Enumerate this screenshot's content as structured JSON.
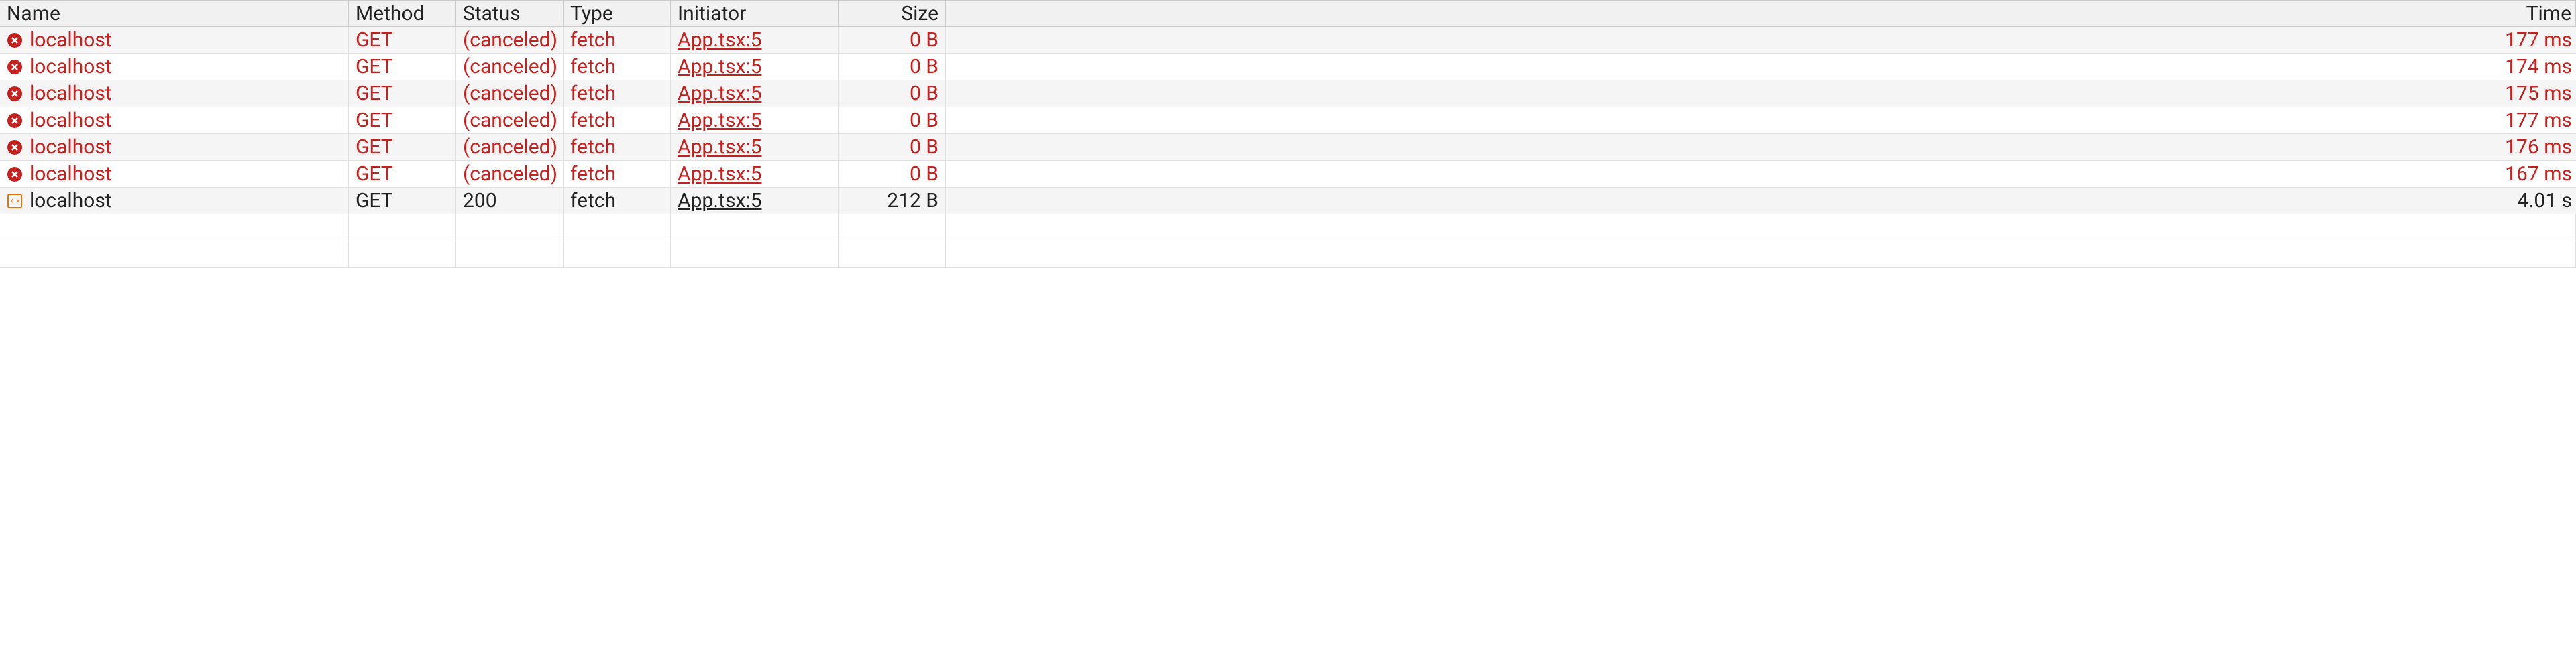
{
  "columns": {
    "name": "Name",
    "method": "Method",
    "status": "Status",
    "type": "Type",
    "initiator": "Initiator",
    "size": "Size",
    "time": "Time"
  },
  "status_colors": {
    "error": "#c5221f",
    "ok": "#222222",
    "script_icon_border": "#e8710a"
  },
  "rows": [
    {
      "icon": "error",
      "name": "localhost",
      "method": "GET",
      "status": "(canceled)",
      "type": "fetch",
      "initiator": "App.tsx:5",
      "size": "0 B",
      "time": "177 ms",
      "state": "err"
    },
    {
      "icon": "error",
      "name": "localhost",
      "method": "GET",
      "status": "(canceled)",
      "type": "fetch",
      "initiator": "App.tsx:5",
      "size": "0 B",
      "time": "174 ms",
      "state": "err"
    },
    {
      "icon": "error",
      "name": "localhost",
      "method": "GET",
      "status": "(canceled)",
      "type": "fetch",
      "initiator": "App.tsx:5",
      "size": "0 B",
      "time": "175 ms",
      "state": "err"
    },
    {
      "icon": "error",
      "name": "localhost",
      "method": "GET",
      "status": "(canceled)",
      "type": "fetch",
      "initiator": "App.tsx:5",
      "size": "0 B",
      "time": "177 ms",
      "state": "err"
    },
    {
      "icon": "error",
      "name": "localhost",
      "method": "GET",
      "status": "(canceled)",
      "type": "fetch",
      "initiator": "App.tsx:5",
      "size": "0 B",
      "time": "176 ms",
      "state": "err"
    },
    {
      "icon": "error",
      "name": "localhost",
      "method": "GET",
      "status": "(canceled)",
      "type": "fetch",
      "initiator": "App.tsx:5",
      "size": "0 B",
      "time": "167 ms",
      "state": "err"
    },
    {
      "icon": "script",
      "name": "localhost",
      "method": "GET",
      "status": "200",
      "type": "fetch",
      "initiator": "App.tsx:5",
      "size": "212 B",
      "time": "4.01 s",
      "state": "ok"
    }
  ]
}
